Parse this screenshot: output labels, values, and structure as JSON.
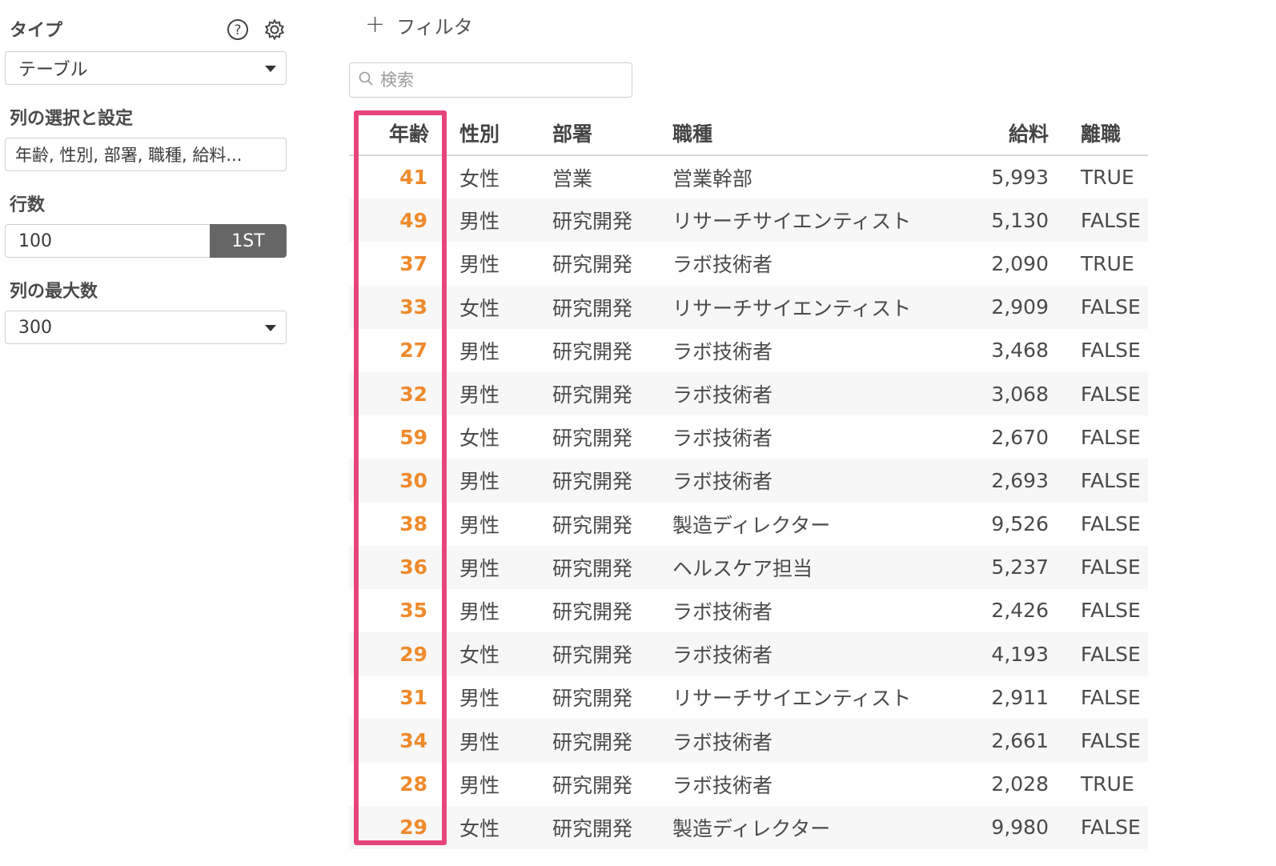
{
  "panel": {
    "type_label": "タイプ",
    "type_value": "テーブル",
    "columns_label": "列の選択と設定",
    "columns_value": "年齢, 性別, 部署, 職種, 給料...",
    "rows_label": "行数",
    "rows_value": "100",
    "rows_button": "1ST",
    "max_cols_label": "列の最大数",
    "max_cols_value": "300",
    "icons": [
      "help-icon",
      "gear-icon",
      "chevron-down-icon",
      "search-icon",
      "plus-icon"
    ]
  },
  "toolbar": {
    "filter_label": "フィルタ",
    "search_placeholder": "検索"
  },
  "table": {
    "headers": [
      "年齢",
      "性別",
      "部署",
      "職種",
      "給料",
      "離職"
    ],
    "rows": [
      [
        "41",
        "女性",
        "営業",
        "営業幹部",
        "5,993",
        "TRUE"
      ],
      [
        "49",
        "男性",
        "研究開発",
        "リサーチサイエンティスト",
        "5,130",
        "FALSE"
      ],
      [
        "37",
        "男性",
        "研究開発",
        "ラボ技術者",
        "2,090",
        "TRUE"
      ],
      [
        "33",
        "女性",
        "研究開発",
        "リサーチサイエンティスト",
        "2,909",
        "FALSE"
      ],
      [
        "27",
        "男性",
        "研究開発",
        "ラボ技術者",
        "3,468",
        "FALSE"
      ],
      [
        "32",
        "男性",
        "研究開発",
        "ラボ技術者",
        "3,068",
        "FALSE"
      ],
      [
        "59",
        "女性",
        "研究開発",
        "ラボ技術者",
        "2,670",
        "FALSE"
      ],
      [
        "30",
        "男性",
        "研究開発",
        "ラボ技術者",
        "2,693",
        "FALSE"
      ],
      [
        "38",
        "男性",
        "研究開発",
        "製造ディレクター",
        "9,526",
        "FALSE"
      ],
      [
        "36",
        "男性",
        "研究開発",
        "ヘルスケア担当",
        "5,237",
        "FALSE"
      ],
      [
        "35",
        "男性",
        "研究開発",
        "ラボ技術者",
        "2,426",
        "FALSE"
      ],
      [
        "29",
        "女性",
        "研究開発",
        "ラボ技術者",
        "4,193",
        "FALSE"
      ],
      [
        "31",
        "男性",
        "研究開発",
        "リサーチサイエンティスト",
        "2,911",
        "FALSE"
      ],
      [
        "34",
        "男性",
        "研究開発",
        "ラボ技術者",
        "2,661",
        "FALSE"
      ],
      [
        "28",
        "男性",
        "研究開発",
        "ラボ技術者",
        "2,028",
        "TRUE"
      ],
      [
        "29",
        "女性",
        "研究開発",
        "製造ディレクター",
        "9,980",
        "FALSE"
      ]
    ]
  },
  "colors": {
    "age_accent": "#ef8a2b",
    "highlight_border": "#e7457a",
    "button_bg": "#666666"
  }
}
